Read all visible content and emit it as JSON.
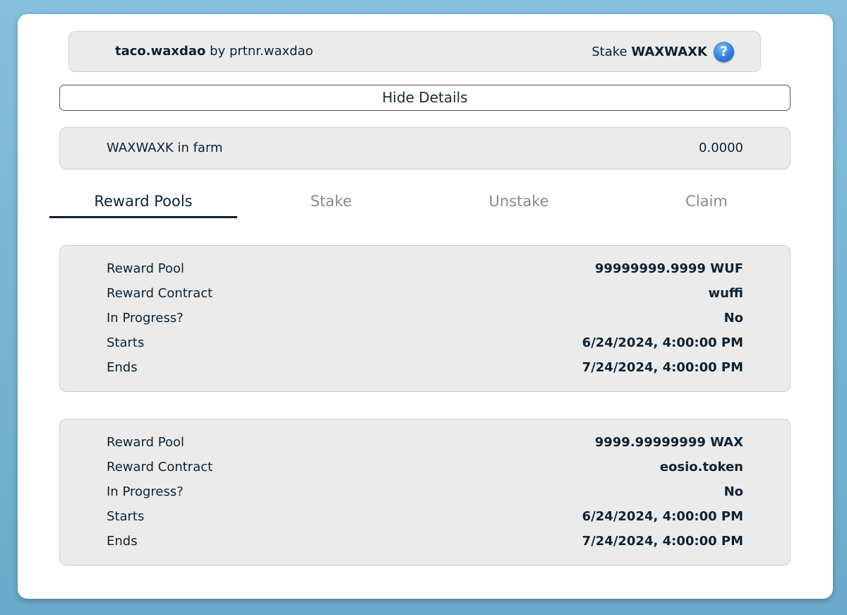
{
  "header": {
    "farm_name": "taco.waxdao",
    "by_text": "by",
    "creator": "prtnr.waxdao",
    "stake_text": "Stake",
    "stake_token": "WAXWAXK",
    "help_glyph": "?"
  },
  "toggle_details_label": "Hide Details",
  "farm_info": {
    "label": "WAXWAXK in farm",
    "value": "0.0000"
  },
  "tabs": [
    {
      "label": "Reward Pools",
      "active": true
    },
    {
      "label": "Stake",
      "active": false
    },
    {
      "label": "Unstake",
      "active": false
    },
    {
      "label": "Claim",
      "active": false
    }
  ],
  "pool_labels": {
    "reward_pool": "Reward Pool",
    "reward_contract": "Reward Contract",
    "in_progress": "In Progress?",
    "starts": "Starts",
    "ends": "Ends"
  },
  "pools": [
    {
      "reward_pool": "99999999.9999 WUF",
      "reward_contract": "wuffi",
      "in_progress": "No",
      "starts": "6/24/2024, 4:00:00 PM",
      "ends": "7/24/2024, 4:00:00 PM"
    },
    {
      "reward_pool": "9999.99999999 WAX",
      "reward_contract": "eosio.token",
      "in_progress": "No",
      "starts": "6/24/2024, 4:00:00 PM",
      "ends": "7/24/2024, 4:00:00 PM"
    }
  ],
  "colors": {
    "background": "#7ab4d4",
    "panel": "#ebebeb",
    "text_dark": "#0e2233",
    "tab_inactive": "#8a8a8a",
    "help_blue": "#2f7fde"
  },
  "icons": {
    "help": "help-icon"
  }
}
